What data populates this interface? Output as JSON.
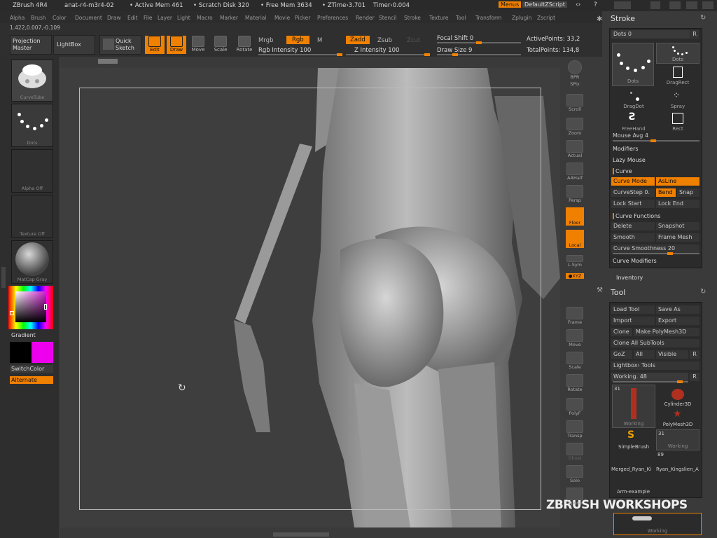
{
  "titlebar": {
    "app": "ZBrush 4R4",
    "file": "anat-r4-m3r4-02",
    "active_mem": "• Active Mem 461",
    "scratch": "• Scratch Disk 320",
    "free_mem": "• Free Mem 3634",
    "ztime": "• ZTime›3.701",
    "timer": "Timer›0.004",
    "menus_btn": "Menus",
    "zscript_btn": "DefaultZScript"
  },
  "menubar": [
    "Alpha",
    "Brush",
    "Color",
    "Document",
    "Draw",
    "Edit",
    "File",
    "Layer",
    "Light",
    "Macro",
    "Marker",
    "Material",
    "Movie",
    "Picker",
    "Preferences",
    "Render",
    "Stencil",
    "Stroke",
    "Texture",
    "Tool",
    "Transform",
    "Zplugin",
    "Zscript"
  ],
  "coords": "1.422,0.007,-0.109",
  "shelf": {
    "projection_master": "Projection Master",
    "lightbox": "LightBox",
    "quick_sketch": "Quick Sketch",
    "edit": "Edit",
    "draw": "Draw",
    "move": "Move",
    "scale": "Scale",
    "rotate": "Rotate",
    "mrgb": "Mrgb",
    "rgb": "Rgb",
    "m": "M",
    "rgb_intensity": "Rgb Intensity 100",
    "zadd": "Zadd",
    "zsub": "Zsub",
    "zcut": "Zcut",
    "z_intensity": "Z Intensity 100",
    "focal_shift": "Focal Shift 0",
    "draw_size": "Draw Size 9",
    "active_points": "ActivePoints: 33,2",
    "total_points": "TotalPoints: 134,8"
  },
  "leftbar": {
    "brush": "CurveTube",
    "stroke": "Dots",
    "alpha": "Alpha Off",
    "texture": "Texture Off",
    "material": "MatCap Gray",
    "gradient": "Gradient",
    "switchcolor": "SwitchColor",
    "alternate": "Alternate",
    "color_main": "#000000",
    "color_sec": "#ee00ee"
  },
  "right_tools": [
    "BPR",
    "SPix",
    "Scroll",
    "Zoom",
    "Actual",
    "AAHalf",
    "Persp",
    "Floor",
    "Local",
    "L.Sym",
    "●XYZ",
    "Frame",
    "Move",
    "Scale",
    "Rotate",
    "PolyF",
    "Transp",
    "Ghost",
    "Solo",
    "Xpose"
  ],
  "stroke_panel": {
    "title": "Stroke",
    "dots": "Dots 0",
    "r": "R",
    "items": [
      "Dots",
      "Dots",
      "DragRect",
      "DragDot",
      "Spray",
      "FreeHand",
      "Rect"
    ],
    "mouse_avg": "Mouse Avg 4",
    "modifiers": "Modifiers",
    "lazy_mouse": "Lazy Mouse",
    "curve": "Curve",
    "curve_mode": "Curve Mode",
    "asline": "AsLine",
    "curvestep": "CurveStep 0.",
    "bend": "Bend",
    "snap": "Snap",
    "lock_start": "Lock Start",
    "lock_end": "Lock End",
    "curve_functions": "Curve Functions",
    "delete": "Delete",
    "snapshot": "Snapshot",
    "smooth": "Smooth",
    "frame_mesh": "Frame Mesh",
    "curve_smoothness": "Curve Smoothness 20",
    "curve_modifiers": "Curve Modifiers"
  },
  "inventory": "Inventory",
  "tool_panel": {
    "title": "Tool",
    "load_tool": "Load Tool",
    "save_as": "Save As",
    "import": "Import",
    "export": "Export",
    "clone": "Clone",
    "make_polymesh": "Make PolyMesh3D",
    "clone_all": "Clone All SubTools",
    "goz": "GoZ",
    "all": "All",
    "visible": "Visible",
    "r": "R",
    "lightbox_tools": "Lightbox› Tools",
    "working": "Working. 48",
    "thumb_count1": "31",
    "thumb1": "Working",
    "cylinder": "Cylinder3D",
    "polymesh": "PolyMesh3D",
    "simplebrush": "SimpleBrush",
    "thumb_count2": "31",
    "thumb2": "Working",
    "count89": "89",
    "merged": "Merged_Ryan_Ki",
    "ryan": "Ryan_Kingslien_A",
    "arm": "Arm-example",
    "bottom_label": "Working"
  },
  "watermark": "ZBRUSH WORKSHOPS"
}
